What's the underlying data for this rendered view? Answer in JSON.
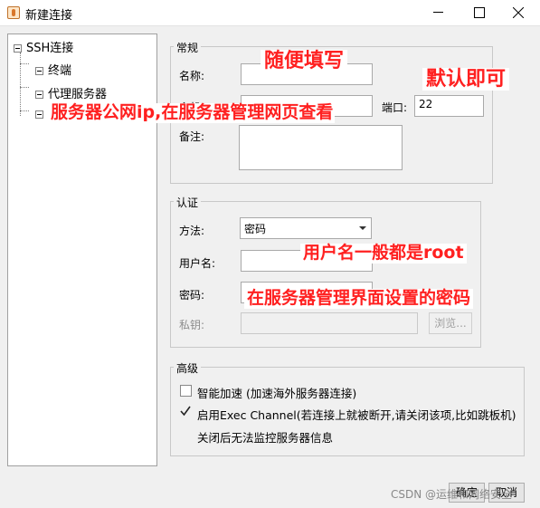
{
  "window": {
    "title": "新建连接"
  },
  "tree": {
    "root": "SSH连接",
    "children": [
      "终端",
      "代理服务器",
      ""
    ]
  },
  "general": {
    "title": "常规",
    "name_label": "名称:",
    "host_label": "主机",
    "port_label": "端口:",
    "port_value": "22",
    "note_label": "备注:"
  },
  "auth": {
    "title": "认证",
    "method_label": "方法:",
    "method_value": "密码",
    "user_label": "用户名:",
    "password_label": "密码:",
    "key_label": "私钥:",
    "browse_label": "浏览..."
  },
  "advanced": {
    "title": "高级",
    "opt1_label": "智能加速 (加速海外服务器连接)",
    "opt1_checked": false,
    "opt2_label": "启用Exec Channel(若连接上就被断开,请关闭该项,比如跳板机)",
    "opt2_checked": true,
    "opt2_note": "关闭后无法监控服务器信息"
  },
  "buttons": {
    "ok": "确定",
    "cancel": "取消"
  },
  "annotations": {
    "name_hint": "随便填写",
    "port_hint": "默认即可",
    "host_hint": "服务器公网ip,在服务器管理网页查看",
    "user_hint": "用户名一般都是root",
    "password_hint": "在服务器管理界面设置的密码",
    "color": "#ff2020"
  },
  "watermark": "CSDN @运维和网络安全"
}
